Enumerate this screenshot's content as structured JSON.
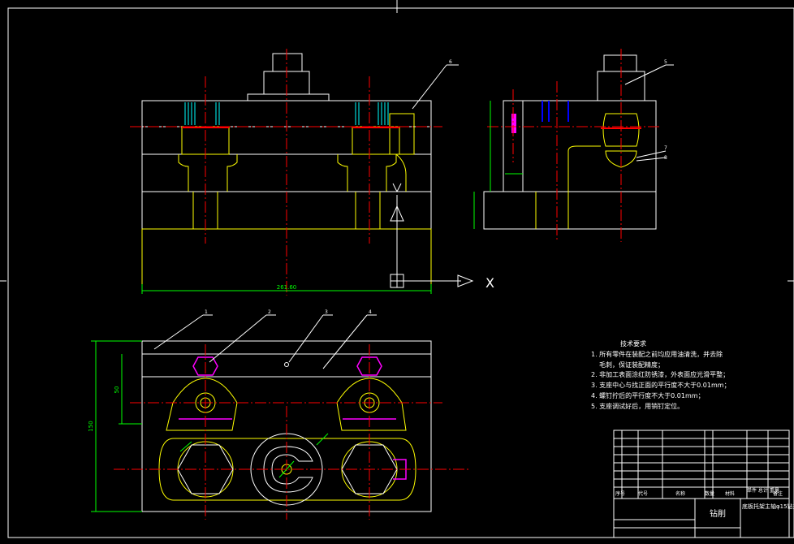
{
  "colors": {
    "background": "#000000",
    "outline": "#ffffff",
    "part": "#ffff00",
    "centerline": "#ff0000",
    "dimension": "#00ff00",
    "hatch": "#00ffff",
    "highlight": "#ff00ff",
    "section": "#0000ff"
  },
  "front_view": {
    "width_dim": "261.60",
    "axis_x_label": "X"
  },
  "bottom_view": {
    "height_dim": "150",
    "inner_dim": "50"
  },
  "callouts": [
    "1",
    "2",
    "3",
    "4",
    "5",
    "6",
    "7",
    "8"
  ],
  "tech_requirements": {
    "title": "技术要求",
    "items": [
      "1. 所有零件在装配之前均应用油清洗，并去除",
      "毛刺，保证装配精度；",
      "2. 非加工表面涂红防锈漆，外表面应光滑平整；",
      "3. 支座中心与找正面的平行度不大于0.01mm；",
      "4. 螺钉拧后的平行度不大于0.01mm；",
      "5. 支座调试好后，用销钉定位。"
    ]
  },
  "title_block": {
    "header": [
      "序号",
      "代号",
      "名称",
      "数量",
      "材料",
      "单件 总计 重量",
      "备注"
    ],
    "center_label": "钻削",
    "drawing_name": "底板托架主轴φ15钻夹具"
  }
}
